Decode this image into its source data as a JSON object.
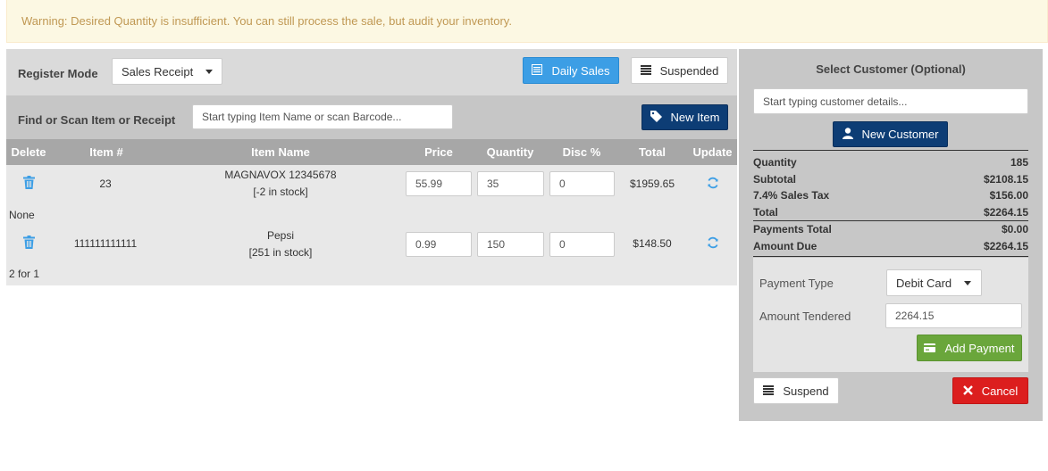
{
  "warning": "Warning: Desired Quantity is insufficient. You can still process the sale, but audit your inventory.",
  "register": {
    "mode_label": "Register Mode",
    "mode_value": "Sales Receipt",
    "daily_sales": "Daily Sales",
    "suspended": "Suspended"
  },
  "find": {
    "label": "Find or Scan Item or Receipt",
    "placeholder": "Start typing Item Name or scan Barcode...",
    "new_item": "New Item"
  },
  "table": {
    "headers": [
      "Delete",
      "Item #",
      "Item Name",
      "Price",
      "Quantity",
      "Disc %",
      "Total",
      "Update"
    ],
    "rows": [
      {
        "item_no": "23",
        "name": "MAGNAVOX 12345678",
        "stock": "[-2 in stock]",
        "price": "55.99",
        "quantity": "35",
        "disc": "0",
        "total": "$1959.65",
        "note": "None"
      },
      {
        "item_no": "111111111111",
        "name": "Pepsi",
        "stock": "[251 in stock]",
        "price": "0.99",
        "quantity": "150",
        "disc": "0",
        "total": "$148.50",
        "note": "2 for 1"
      }
    ]
  },
  "customer": {
    "title": "Select Customer (Optional)",
    "placeholder": "Start typing customer details...",
    "new_customer": "New Customer"
  },
  "summary": {
    "quantity_label": "Quantity",
    "quantity": "185",
    "subtotal_label": "Subtotal",
    "subtotal": "$2108.15",
    "tax_label": "7.4% Sales Tax",
    "tax": "$156.00",
    "total_label": "Total",
    "total": "$2264.15",
    "payments_label": "Payments Total",
    "payments": "$0.00",
    "due_label": "Amount Due",
    "due": "$2264.15"
  },
  "payment": {
    "type_label": "Payment Type",
    "type_value": "Debit Card",
    "tendered_label": "Amount Tendered",
    "tendered_value": "2264.15",
    "add_payment": "Add Payment"
  },
  "actions": {
    "suspend": "Suspend",
    "cancel": "Cancel"
  },
  "colors": {
    "navy": "#0d3d75",
    "light_blue": "#3c9ee5",
    "green": "#6aa63b",
    "red": "#dc1e1e",
    "warning_text": "#c09853"
  }
}
